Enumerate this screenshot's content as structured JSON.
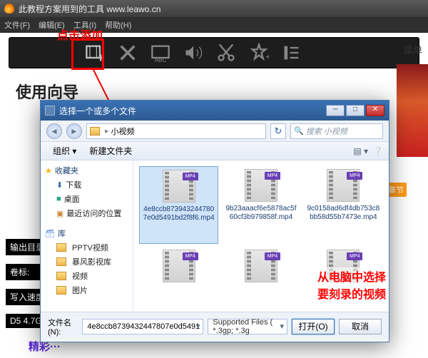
{
  "title": "此教程方案用到的工具  www.leawo.cn",
  "menu": {
    "file": "文件(F)",
    "edit": "编辑(E)",
    "tool": "工具(I)",
    "help": "帮助(H)"
  },
  "side_menu": "菜单",
  "header": "使用向导",
  "anno_add": "点击添加",
  "anno_select": "从电脑中选择要刻录的视频",
  "labels": {
    "out": "输出目录:",
    "vol": "卷标:",
    "speed": "写入速度:",
    "disc": "D5 4.7G"
  },
  "bottom_purple": "精彩···",
  "plus_tag": "加章节",
  "dialog": {
    "title": "选择一个或多个文件",
    "path": {
      "root": "",
      "cur": "小视频"
    },
    "search_placeholder": "搜索 小视频",
    "org": "组织 ▾",
    "newfolder": "新建文件夹",
    "tree": {
      "fav": "收藏夹",
      "fav_items": [
        "下载",
        "桌面",
        "最近访问的位置"
      ],
      "lib": "库",
      "lib_items": [
        "PPTV视频",
        "暴风影视库",
        "视频",
        "图片"
      ]
    },
    "files": [
      {
        "name": "4e8ccb8739432447807e0d5491bd2f8f6.mp4",
        "sel": true
      },
      {
        "name": "9b23aaacf6e5878ac5f60cf3b979858f.mp4"
      },
      {
        "name": "9c0158ad6df4db753c8bb58d55b7473e.mp4"
      },
      {
        "name": ""
      },
      {
        "name": ""
      },
      {
        "name": ""
      }
    ],
    "fn_label": "文件名(N):",
    "fn_value": "4e8ccb8739432447807e0d5491",
    "filter": "Supported Files ( *.3gp; *.3g",
    "open": "打开(O)",
    "cancel": "取消"
  }
}
